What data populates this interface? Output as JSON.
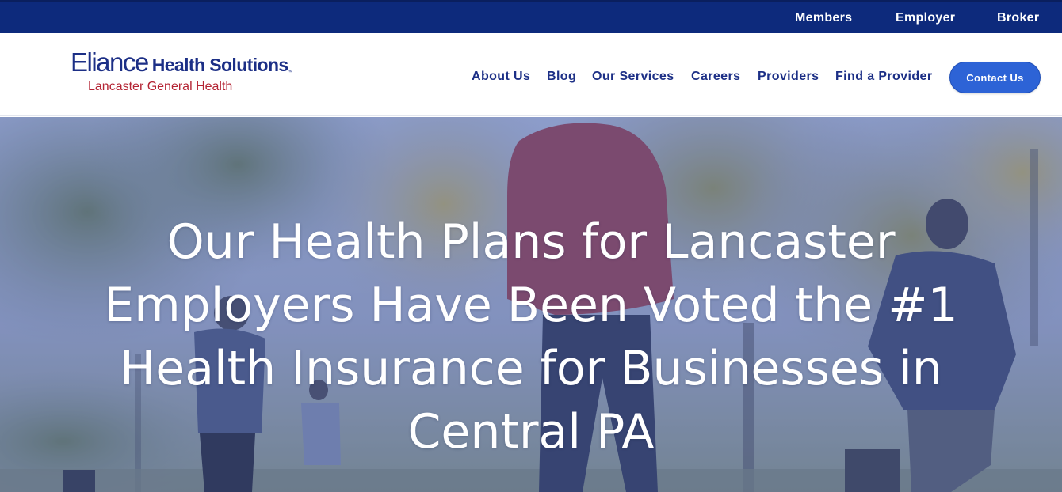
{
  "topbar": {
    "links": [
      {
        "label": "Members"
      },
      {
        "label": "Employer"
      },
      {
        "label": "Broker"
      }
    ]
  },
  "logo": {
    "wordmark": "Eliance",
    "product": "Health Solutions",
    "trademark": "™",
    "tagline": "Lancaster General Health"
  },
  "nav": {
    "items": [
      {
        "label": "About Us"
      },
      {
        "label": "Blog"
      },
      {
        "label": "Our Services"
      },
      {
        "label": "Careers"
      },
      {
        "label": "Providers"
      },
      {
        "label": "Find a Provider"
      }
    ],
    "cta_label": "Contact Us"
  },
  "hero": {
    "headline_lines": [
      "Our Health Plans for Lancaster",
      "Employers Have Been Voted the #1",
      "Health Insurance for Businesses in",
      "Central PA"
    ]
  },
  "colors": {
    "topbar": "#0d2a7c",
    "brand_blue": "#1c2f86",
    "brand_red": "#b42434",
    "cta_blue": "#2d63d6"
  },
  "icons": []
}
